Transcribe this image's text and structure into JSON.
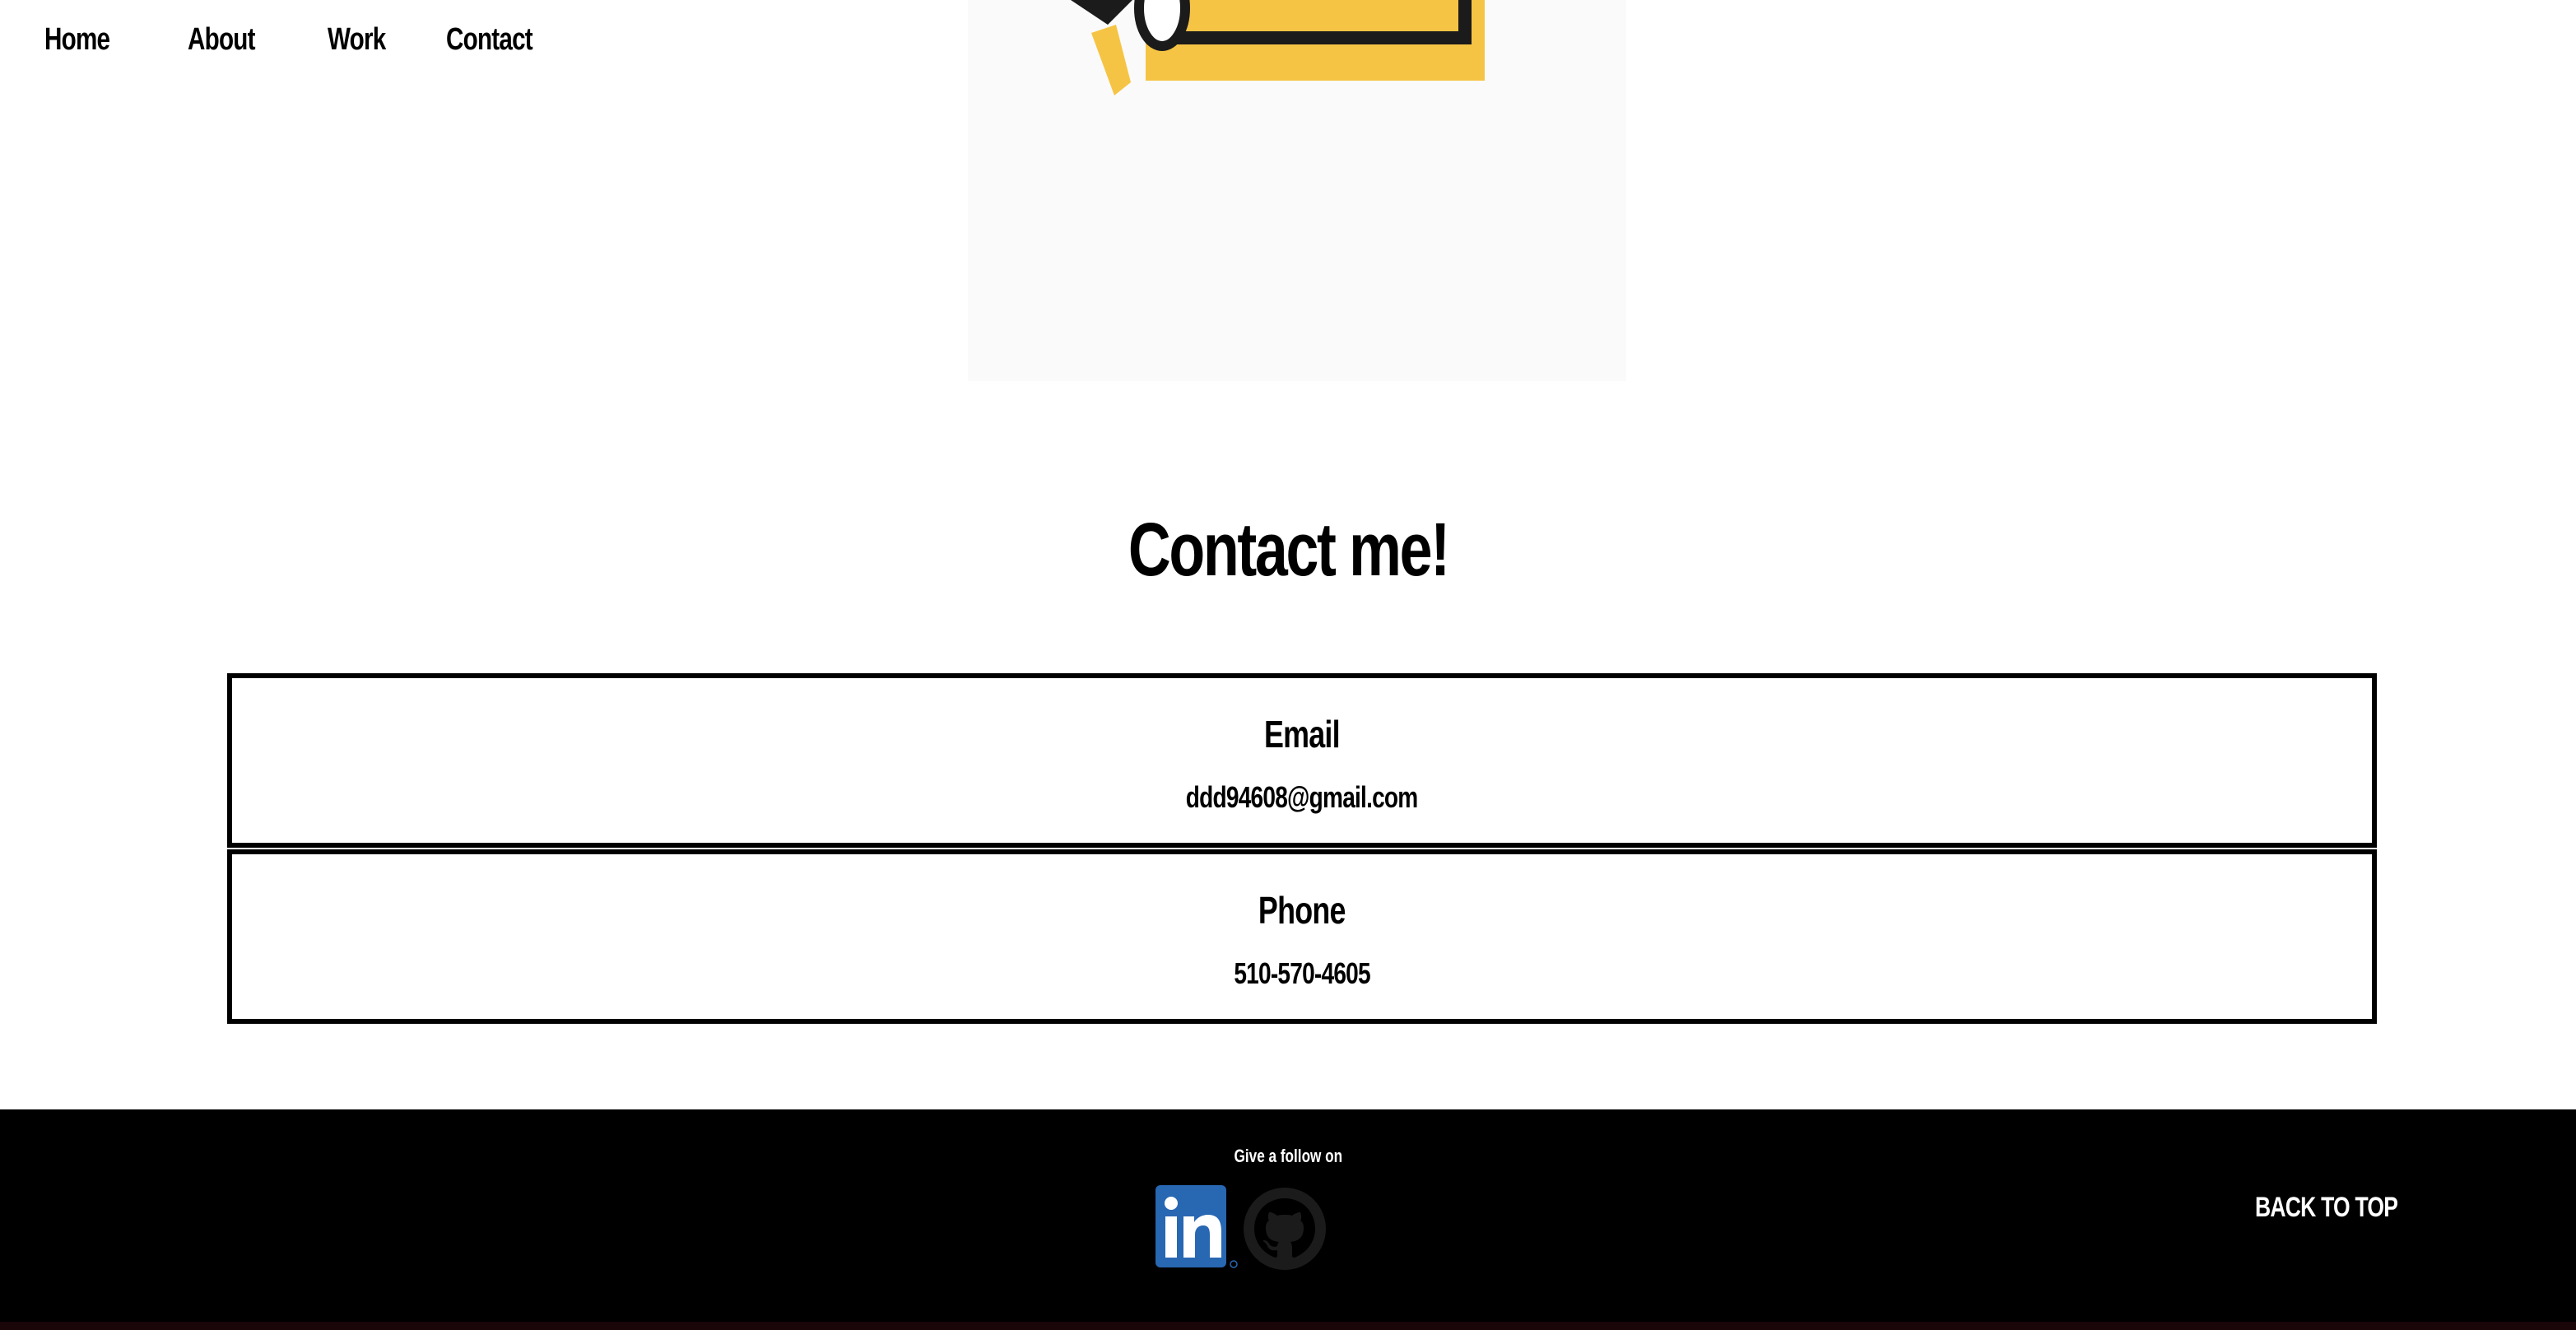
{
  "nav": {
    "items": [
      {
        "label": "Home"
      },
      {
        "label": "About"
      },
      {
        "label": "Work"
      },
      {
        "label": "Contact"
      }
    ]
  },
  "contact": {
    "title": "Contact me!",
    "email": {
      "label": "Email",
      "value": "ddd94608@gmail.com"
    },
    "phone": {
      "label": "Phone",
      "value": "510-570-4605"
    }
  },
  "footer": {
    "follow_text": "Give a follow on",
    "social": [
      {
        "icon": "linkedin-icon",
        "color": "#2867b2"
      },
      {
        "icon": "github-icon",
        "color": "#1b1b1b"
      }
    ],
    "back_to_top": "BACK TO TOP"
  },
  "colors": {
    "accent_yellow": "#f6c444",
    "footer_bg": "#000000",
    "image_bg": "#fafafa"
  }
}
